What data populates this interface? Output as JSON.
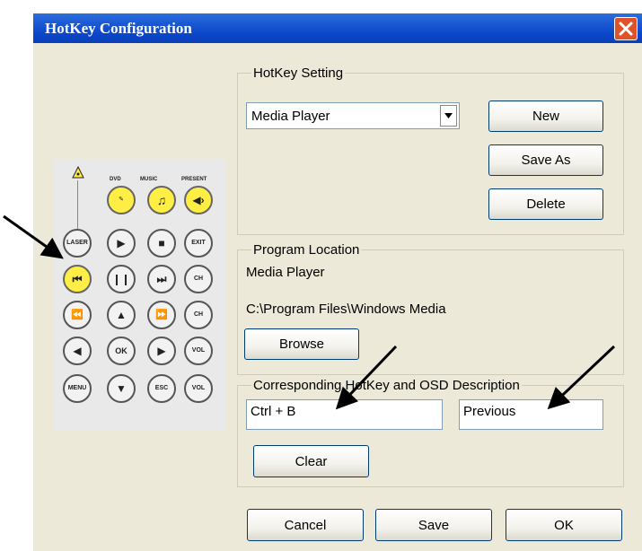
{
  "window": {
    "title": "HotKey Configuration"
  },
  "hotkey_setting": {
    "legend": "HotKey Setting",
    "selected_program": "Media Player",
    "buttons": {
      "new": "New",
      "save_as": "Save As",
      "delete": "Delete"
    }
  },
  "program_location": {
    "legend": "Program Location",
    "program_name": "Media Player",
    "path": "C:\\Program Files\\Windows Media",
    "browse_label": "Browse"
  },
  "corresponding": {
    "legend": "Corresponding HotKey and OSD Description",
    "hotkey_value": "Ctrl + B",
    "osd_value": "Previous",
    "clear_label": "Clear"
  },
  "footer": {
    "cancel": "Cancel",
    "save": "Save",
    "ok": "OK"
  },
  "remote": {
    "labels": {
      "dvd": "DVD",
      "music": "MUSIC",
      "present": "PRESENT",
      "laser": "LASER",
      "exit": "EXIT",
      "ch": "CH",
      "vol": "VOL",
      "ok": "OK",
      "menu": "MENU",
      "esc": "ESC"
    },
    "highlighted_button": "previous-track",
    "highlight_color": "#ffee44"
  },
  "colors": {
    "titlebar": "#0a46c9",
    "dialog_bg": "#ece9d8",
    "close_button": "#e0522a"
  }
}
